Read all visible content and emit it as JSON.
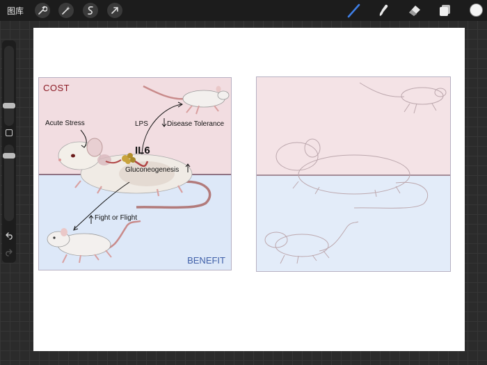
{
  "toolbar": {
    "gallery_label": "图库",
    "left_tools": [
      "wrench-icon",
      "magic-wand-icon",
      "selection-icon",
      "transform-icon"
    ],
    "right_tools": [
      "brush-icon",
      "smudge-icon",
      "eraser-icon",
      "layers-icon"
    ],
    "active_tool": "brush-icon",
    "current_color": "#f4f4f4"
  },
  "colors": {
    "cost_pane": "#f2dde1",
    "benefit_pane": "#dde8f8",
    "cost_text": "#8b1a24",
    "benefit_text": "#3f5fa8",
    "brush_active": "#3f7fe6"
  },
  "figure": {
    "cost_label": "COST",
    "benefit_label": "BENEFIT",
    "acute_stress": "Acute Stress",
    "lps": "LPS",
    "disease_tolerance": "Disease Tolerance",
    "il6": "IL6",
    "gluconeogenesis": "Gluconeogenesis",
    "fight_or_flight": "Fight or Flight"
  }
}
